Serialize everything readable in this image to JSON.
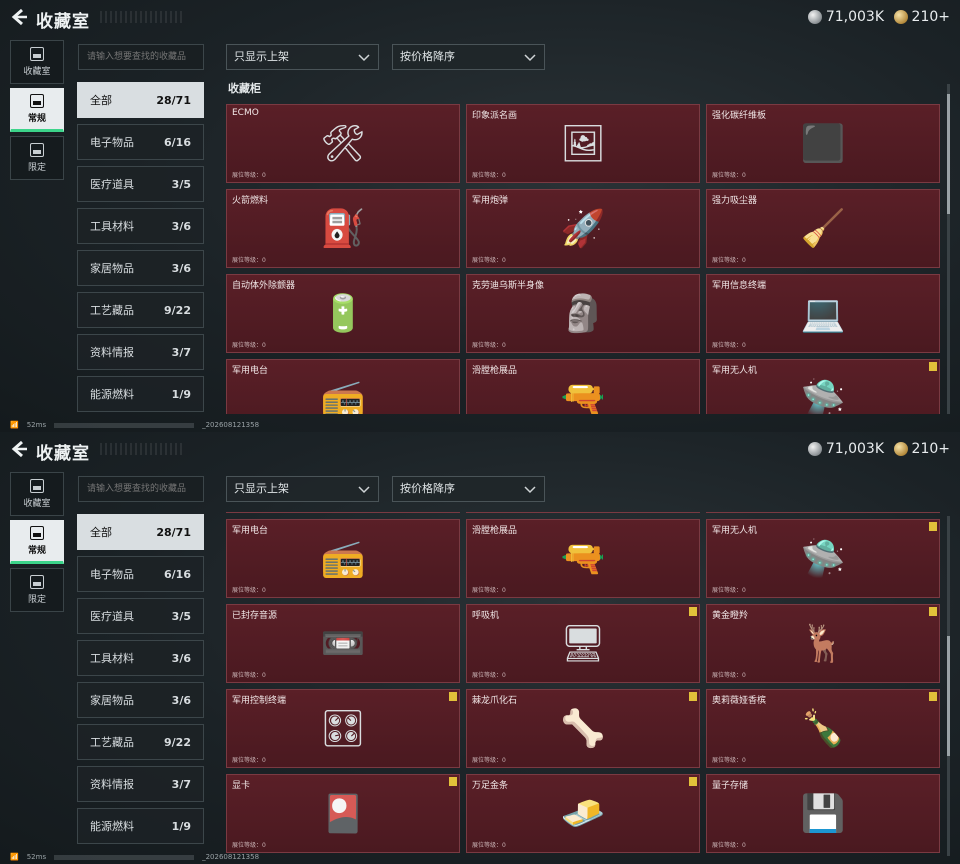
{
  "header": {
    "title": "收藏室",
    "currency1": "71,003K",
    "currency2": "210+"
  },
  "nav": [
    {
      "label": "收藏室",
      "icon": "collection-icon"
    },
    {
      "label": "常规",
      "icon": "picture-icon",
      "active": true
    },
    {
      "label": "限定",
      "icon": "limited-icon"
    }
  ],
  "search": {
    "placeholder": "请输入想要查找的收藏品"
  },
  "filters": {
    "display": "只显示上架",
    "sort": "按价格降序"
  },
  "categories": [
    {
      "label": "全部",
      "count": "28/71",
      "active": true
    },
    {
      "label": "电子物品",
      "count": "6/16"
    },
    {
      "label": "医疗道具",
      "count": "3/5"
    },
    {
      "label": "工具材料",
      "count": "3/6"
    },
    {
      "label": "家居物品",
      "count": "3/6"
    },
    {
      "label": "工艺藏品",
      "count": "9/22"
    },
    {
      "label": "资料情报",
      "count": "3/7"
    },
    {
      "label": "能源燃料",
      "count": "1/9"
    }
  ],
  "section_label": "收藏柜",
  "level_label": "展位等级：0",
  "status": {
    "ping": "52ms",
    "build": "_202608121358"
  },
  "items": [
    {
      "name": "ECMO",
      "icon": "ecmo-icon",
      "glyph": "🛠",
      "badge": false
    },
    {
      "name": "印象派名画",
      "icon": "painting-icon",
      "glyph": "🖼",
      "badge": false
    },
    {
      "name": "强化碳纤维板",
      "icon": "carbon-plate-icon",
      "glyph": "⬛",
      "badge": false
    },
    {
      "name": "火箭燃料",
      "icon": "fuel-can-icon",
      "glyph": "⛽",
      "badge": false
    },
    {
      "name": "军用炮弹",
      "icon": "shell-icon",
      "glyph": "🚀",
      "badge": false
    },
    {
      "name": "强力吸尘器",
      "icon": "vacuum-icon",
      "glyph": "🧹",
      "badge": false
    },
    {
      "name": "自动体外除颤器",
      "icon": "defibrillator-icon",
      "glyph": "🔋",
      "badge": false
    },
    {
      "name": "克劳迪乌斯半身像",
      "icon": "bust-icon",
      "glyph": "🗿",
      "badge": false
    },
    {
      "name": "军用信息终端",
      "icon": "terminal-icon",
      "glyph": "💻",
      "badge": false
    },
    {
      "name": "军用电台",
      "icon": "radio-icon",
      "glyph": "📻",
      "badge": false
    },
    {
      "name": "滑膛枪展品",
      "icon": "musket-icon",
      "glyph": "🔫",
      "badge": false
    },
    {
      "name": "军用无人机",
      "icon": "drone-icon",
      "glyph": "🛸",
      "badge": true
    },
    {
      "name": "已封存音源",
      "icon": "tape-recorder-icon",
      "glyph": "📼",
      "badge": false
    },
    {
      "name": "呼吸机",
      "icon": "ventilator-icon",
      "glyph": "🖥",
      "badge": true
    },
    {
      "name": "黄金瞪羚",
      "icon": "gazelle-icon",
      "glyph": "🦌",
      "badge": true
    },
    {
      "name": "军用控制终端",
      "icon": "control-terminal-icon",
      "glyph": "🎛",
      "badge": true
    },
    {
      "name": "棘龙爪化石",
      "icon": "claw-fossil-icon",
      "glyph": "🦴",
      "badge": true
    },
    {
      "name": "奥莉薇娅香槟",
      "icon": "champagne-icon",
      "glyph": "🍾",
      "badge": true
    },
    {
      "name": "显卡",
      "icon": "gpu-icon",
      "glyph": "🎴",
      "badge": true
    },
    {
      "name": "万足金条",
      "icon": "gold-bar-icon",
      "glyph": "🧈",
      "badge": true
    },
    {
      "name": "量子存储",
      "icon": "quantum-storage-icon",
      "glyph": "💾",
      "badge": false
    }
  ]
}
